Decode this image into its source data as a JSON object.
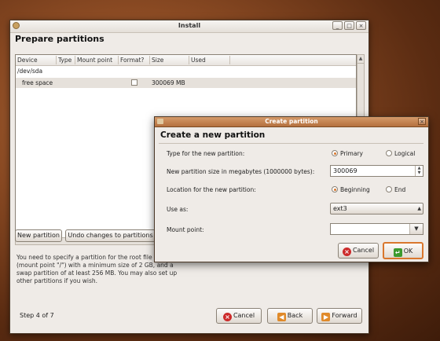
{
  "window": {
    "title": "Install",
    "minimize": "_",
    "maximize": "□",
    "close": "×"
  },
  "page": {
    "heading": "Prepare partitions"
  },
  "table": {
    "columns": [
      "Device",
      "Type",
      "Mount point",
      "Format?",
      "Size",
      "Used"
    ],
    "rows": [
      {
        "device": "/dev/sda",
        "type": "",
        "mount": "",
        "format": "",
        "size": "",
        "used": ""
      },
      {
        "device": "free space",
        "type": "",
        "mount": "",
        "format": "unchecked",
        "size": "300069 MB",
        "used": ""
      }
    ]
  },
  "buttons": {
    "new_partition": "New partition",
    "undo": "Undo changes to partitions",
    "cancel": "Cancel",
    "back": "Back",
    "forward": "Forward"
  },
  "description": "You need to specify a partition for the root file system (mount point \"/\") with a minimum size of 2 GB, and a swap partition of at least 256 MB. You may also set up other partitions if you wish.",
  "step": "Step 4 of 7",
  "dialog": {
    "title": "Create partition",
    "close": "×",
    "heading": "Create a new partition",
    "type_label": "Type for the new partition:",
    "type_options": [
      "Primary",
      "Logical"
    ],
    "type_selected": "Primary",
    "size_label": "New partition size in megabytes (1000000 bytes):",
    "size_value": "300069",
    "location_label": "Location for the new partition:",
    "location_options": [
      "Beginning",
      "End"
    ],
    "location_selected": "Beginning",
    "useas_label": "Use as:",
    "useas_value": "ext3",
    "mount_label": "Mount point:",
    "mount_value": "",
    "cancel": "Cancel",
    "ok": "OK"
  },
  "colors": {
    "accent": "#d9772d",
    "titlebar_active": "#b4703e",
    "desktop": "#7a3f1c"
  }
}
